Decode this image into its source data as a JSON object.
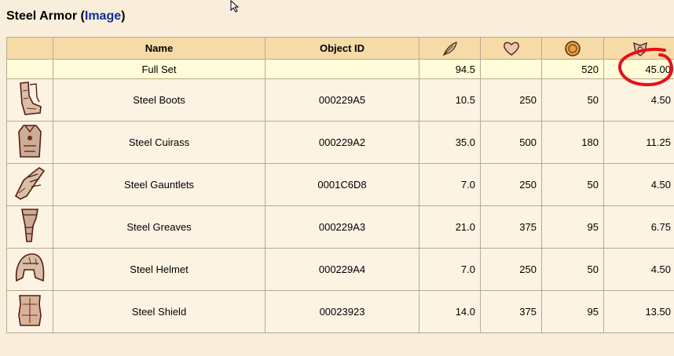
{
  "title": {
    "prefix": "Steel Armor (",
    "link": "Image",
    "suffix": ")"
  },
  "headers": {
    "name": "Name",
    "object_id": "Object ID",
    "weight_icon": "feather-icon",
    "health_icon": "heart-icon",
    "value_icon": "gold-coin-icon",
    "armor_icon": "armor-rating-icon"
  },
  "full_set": {
    "name": "Full Set",
    "object_id": "",
    "weight": "94.5",
    "health": "",
    "value": "520",
    "armor": "45.00"
  },
  "items": [
    {
      "icon": "steel-boots-icon",
      "name": "Steel Boots",
      "object_id": "000229A5",
      "weight": "10.5",
      "health": "250",
      "value": "50",
      "armor": "4.50"
    },
    {
      "icon": "steel-cuirass-icon",
      "name": "Steel Cuirass",
      "object_id": "000229A2",
      "weight": "35.0",
      "health": "500",
      "value": "180",
      "armor": "11.25"
    },
    {
      "icon": "steel-gauntlets-icon",
      "name": "Steel Gauntlets",
      "object_id": "0001C6D8",
      "weight": "7.0",
      "health": "250",
      "value": "50",
      "armor": "4.50"
    },
    {
      "icon": "steel-greaves-icon",
      "name": "Steel Greaves",
      "object_id": "000229A3",
      "weight": "21.0",
      "health": "375",
      "value": "95",
      "armor": "6.75"
    },
    {
      "icon": "steel-helmet-icon",
      "name": "Steel Helmet",
      "object_id": "000229A4",
      "weight": "7.0",
      "health": "250",
      "value": "50",
      "armor": "4.50"
    },
    {
      "icon": "steel-shield-icon",
      "name": "Steel Shield",
      "object_id": "00023923",
      "weight": "14.0",
      "health": "375",
      "value": "95",
      "armor": "13.50"
    }
  ],
  "colors": {
    "header_bg": "#f6dba8",
    "fullset_bg": "#fffcd7",
    "row_bg": "#fdf3e3",
    "link": "#0b2f9a",
    "annotation": "#e8101a"
  }
}
